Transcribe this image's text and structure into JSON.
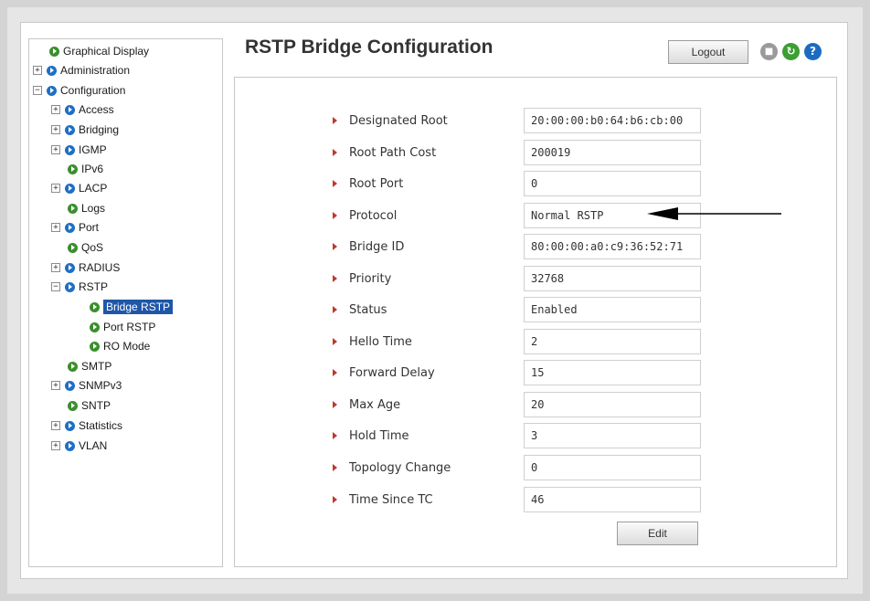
{
  "page_title": "RSTP Bridge Configuration",
  "toolbar": {
    "logout_label": "Logout",
    "icons": [
      "save-icon",
      "refresh-icon",
      "help-icon"
    ],
    "colors": {
      "save": "#9a9a9a",
      "refresh": "#3d9e32",
      "help": "#1d6bc1"
    }
  },
  "sidebar": {
    "items": [
      {
        "label": "Graphical Display",
        "expander": "",
        "bullet": "green"
      },
      {
        "label": "Administration",
        "expander": "+",
        "bullet": "blue"
      },
      {
        "label": "Configuration",
        "expander": "−",
        "bullet": "blue"
      },
      {
        "label": "Access",
        "expander": "+",
        "bullet": "blue"
      },
      {
        "label": "Bridging",
        "expander": "+",
        "bullet": "blue"
      },
      {
        "label": "IGMP",
        "expander": "+",
        "bullet": "blue"
      },
      {
        "label": "IPv6",
        "expander": "",
        "bullet": "green"
      },
      {
        "label": "LACP",
        "expander": "+",
        "bullet": "blue"
      },
      {
        "label": "Logs",
        "expander": "",
        "bullet": "green"
      },
      {
        "label": "Port",
        "expander": "+",
        "bullet": "blue"
      },
      {
        "label": "QoS",
        "expander": "",
        "bullet": "green"
      },
      {
        "label": "RADIUS",
        "expander": "+",
        "bullet": "blue"
      },
      {
        "label": "RSTP",
        "expander": "−",
        "bullet": "blue"
      },
      {
        "label": "Bridge RSTP",
        "expander": "",
        "bullet": "green",
        "selected": true
      },
      {
        "label": "Port RSTP",
        "expander": "",
        "bullet": "green"
      },
      {
        "label": "RO Mode",
        "expander": "",
        "bullet": "green"
      },
      {
        "label": "SMTP",
        "expander": "",
        "bullet": "green"
      },
      {
        "label": "SNMPv3",
        "expander": "+",
        "bullet": "blue"
      },
      {
        "label": "SNTP",
        "expander": "",
        "bullet": "green"
      },
      {
        "label": "Statistics",
        "expander": "+",
        "bullet": "blue"
      },
      {
        "label": "VLAN",
        "expander": "+",
        "bullet": "blue"
      }
    ],
    "colors": {
      "green": "#3a8f2c",
      "blue": "#1e6fc4",
      "selected_bg": "#1f56a8"
    }
  },
  "fields": [
    {
      "label": "Designated Root",
      "value": "20:00:00:b0:64:b6:cb:00"
    },
    {
      "label": "Root Path Cost",
      "value": "200019"
    },
    {
      "label": "Root Port",
      "value": "0"
    },
    {
      "label": "Protocol",
      "value": "Normal RSTP"
    },
    {
      "label": "Bridge ID",
      "value": "80:00:00:a0:c9:36:52:71"
    },
    {
      "label": "Priority",
      "value": "32768"
    },
    {
      "label": "Status",
      "value": "Enabled"
    },
    {
      "label": "Hello Time",
      "value": "2"
    },
    {
      "label": "Forward Delay",
      "value": "15"
    },
    {
      "label": "Max Age",
      "value": "20"
    },
    {
      "label": "Hold Time",
      "value": "3"
    },
    {
      "label": "Topology Change",
      "value": "0"
    },
    {
      "label": "Time Since TC",
      "value": "46"
    }
  ],
  "edit_label": "Edit",
  "annotation_arrow_icon": "left-arrow-icon"
}
